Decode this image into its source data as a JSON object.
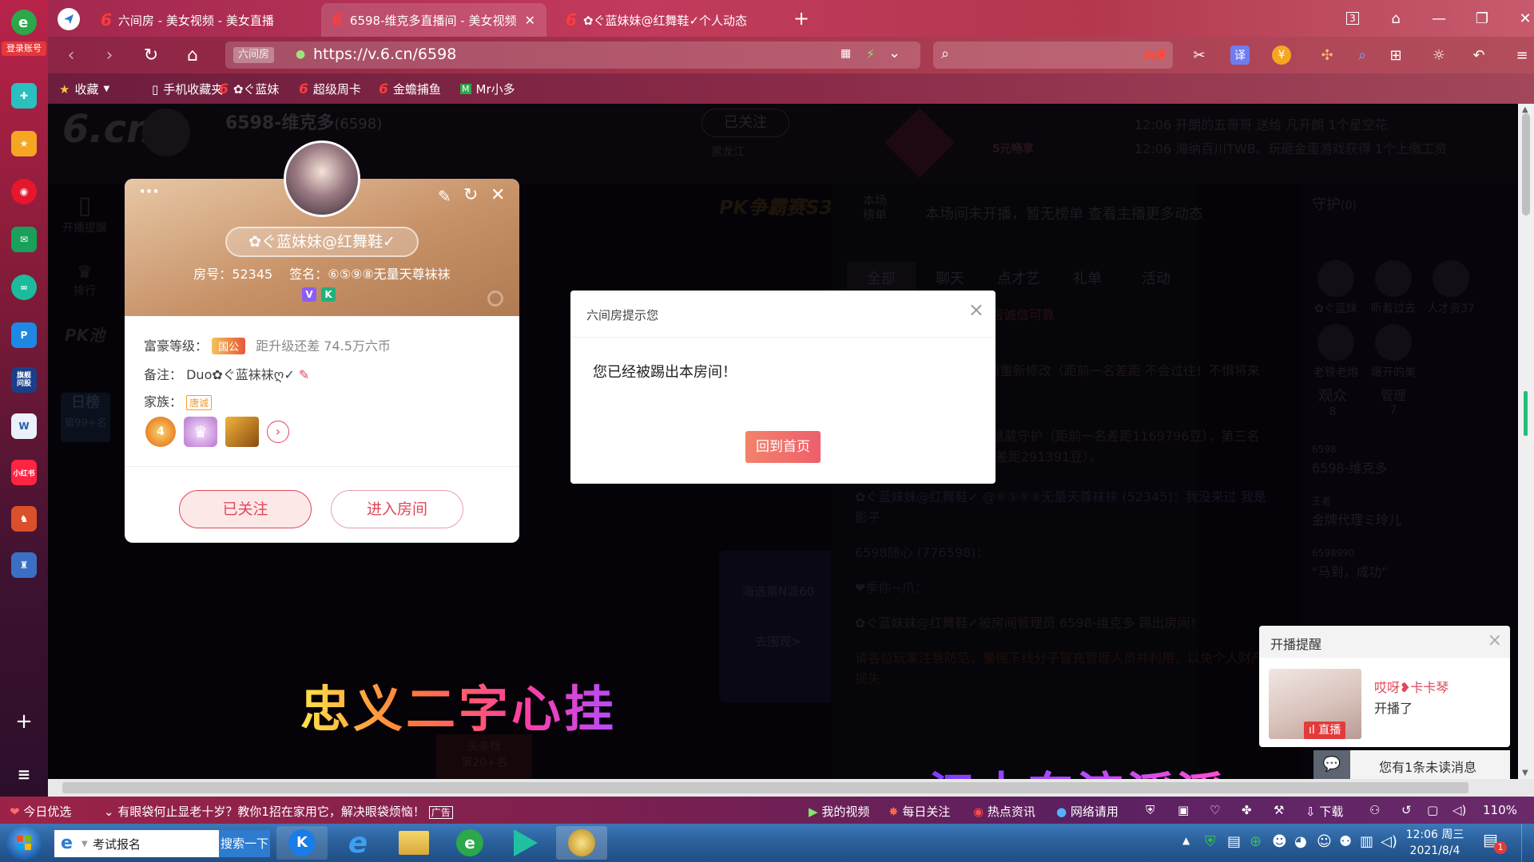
{
  "left_dock": {
    "login_label": "登录账号",
    "items": [
      "compass-icon",
      "star-icon",
      "weibo-icon",
      "mail-icon",
      "cloud-icon",
      "p-icon",
      "finance-icon",
      "word-icon",
      "xiaohongshu-icon",
      "game-icon",
      "game2-icon"
    ],
    "finance_label": "旗舰\n问股",
    "xhs_label": "小红书"
  },
  "tabs": [
    {
      "title": "六间房 - 美女视频 - 美女直播",
      "active": false
    },
    {
      "title": "6598-维克多直播间 - 美女视频",
      "active": true
    },
    {
      "title": "✿ぐ蓝妹妹@红舞鞋✓个人动态",
      "active": false
    }
  ],
  "window": {
    "tab_count": "3"
  },
  "address": {
    "site_label": "六间房",
    "url": "https://v.6.cn/6598"
  },
  "search": {
    "placeholder": "",
    "hot_label": "热搜"
  },
  "bookmarks": [
    {
      "label": "收藏",
      "icon": "star-icon"
    },
    {
      "label": "手机收藏夹",
      "icon": "phone-icon"
    },
    {
      "label": "✿ぐ蓝妹",
      "icon": "six-icon"
    },
    {
      "label": "超级周卡",
      "icon": "six-icon"
    },
    {
      "label": "金蟾捕鱼",
      "icon": "six-icon"
    },
    {
      "label": "Mr小多",
      "icon": "mr-icon"
    }
  ],
  "room": {
    "anchor_name": "6598-维克多",
    "anchor_id": "(6598)",
    "follow_label": "已关注",
    "location": "黑龙江",
    "nav": [
      "开播提醒",
      "排行",
      "PK池"
    ],
    "ranking_label": "日榜",
    "ranking_value": "第99+名",
    "marquee": [
      "12:06  开朗的五哥哥 送给 凡开朗 1个星空花",
      "12:06  海纳百川TWB。玩砸金蛋游戏获得 1个上缴工资"
    ],
    "no_rank_text": "本场间未开播，暂无榜单  查看主播更多动态",
    "rank_tab": "本场\n榜单",
    "chat_tabs": [
      "全部",
      "聊天",
      "点才艺",
      "礼单",
      "活动"
    ],
    "guard_label": "守护",
    "guard_count": "(0)",
    "audience_label": "观众",
    "audience_count": "8",
    "manager_label": "管理",
    "manager_count": "7",
    "pk_banner": "PK争霸赛S3",
    "yuan_label": "5元畅享",
    "event_label": "海选第N派60",
    "event_link": "去围观>",
    "rank_badge": "头条榜\n第20+名",
    "chat_lines": [
      "代理 代理找玲姐 金牌老店诚信可靠",
      "阳之潮，第二名距前边-请重新修改（距前一名差距 不会过往！不惧将来（距前一名差距172012",
      "名：卡卡C，第二名乐是慧葳守护（距前一名差距1169796豆），第三名顾孩子@兑那（距前一名差距291391豆）。",
      "✿ぐ蓝妹妹@红舞鞋✓ @⑥⑤⑨⑧无量天尊袜袜 (52345)：我没来过 我是影子",
      "6598随心 (776598)：",
      "❤季你~爪：",
      "✿ぐ蓝妹妹@红舞鞋✓被房间管理员 6598-维克多 踢出房间！",
      "请各位玩家注意防范，警惕下线分子冒充管理人员并利用，以免个人财产损失"
    ],
    "guard_users": [
      "✿ぐ蓝妹",
      "听着过去",
      "人才资37",
      "老铁老炮",
      "爆开的美"
    ],
    "side_users": [
      {
        "name": "6598-维克多",
        "badge": "6598"
      },
      {
        "name": "金牌代理ミ玲儿",
        "badge": "王者"
      },
      {
        "name": "\"马到，成功\"",
        "badge": "6598990"
      }
    ]
  },
  "profile": {
    "name": "✿ぐ蓝妹妹@红舞鞋✓",
    "room_label": "房号：52345",
    "sign_label": "签名：⑥⑤⑨⑧无量天尊袜袜",
    "badge_v": "V",
    "badge_k": "K",
    "wealth_label": "富豪等级：",
    "wealth_badge": "国公",
    "wealth_gap": "距升级还差 74.5万六币",
    "note_label": "备注：",
    "note_value": "Duo✿ぐ蓝袜袜ღ✓",
    "family_label": "家族：",
    "family_value": "唐诚",
    "level_num": "4",
    "follow_btn": "已关注",
    "enter_btn": "进入房间",
    "more_label": "···"
  },
  "dialog": {
    "title": "六间房提示您",
    "message": "您已经被踢出本房间！",
    "button": "回到首页"
  },
  "lyrics": {
    "line1": "忠义二字心挂",
    "line2": "江水东流滔滔"
  },
  "live_popup": {
    "title": "开播提醒",
    "name": "哎呀❥卡卡琴",
    "status": "开播了",
    "tag": "直播"
  },
  "unread": {
    "text": "您有1条未读消息"
  },
  "status_bar": {
    "today": "今日优选",
    "news": "有眼袋何止显老十岁？教你1招在家用它，解决眼袋烦恼！",
    "ad_label": "广告",
    "items": [
      "我的视频",
      "每日关注",
      "热点资讯",
      "网络请用",
      "下载"
    ],
    "zoom": "110%"
  },
  "taskbar": {
    "search_text": "考试报名",
    "search_btn": "搜索一下",
    "time": "12:06 周三",
    "date": "2021/8/4",
    "notif_count": "1"
  },
  "colors": {
    "accent": "#e0475a",
    "dialog_btn": "#ee5f6b",
    "brand_red": "#ff3c3c"
  }
}
